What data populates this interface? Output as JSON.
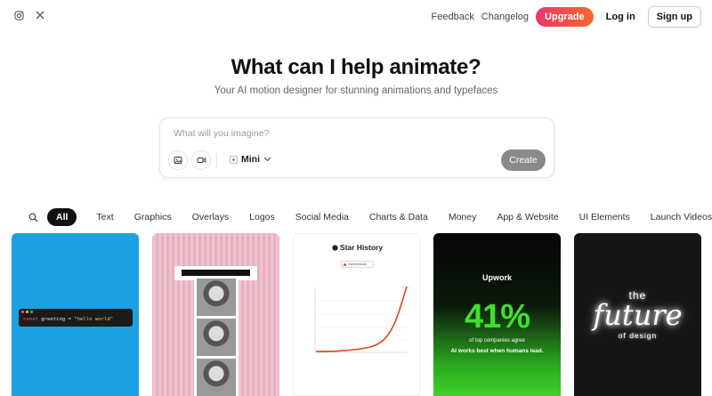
{
  "header": {
    "social": [
      {
        "icon": "instagram-icon"
      },
      {
        "icon": "x-icon"
      }
    ],
    "feedback": "Feedback",
    "changelog": "Changelog",
    "upgrade": "Upgrade",
    "login": "Log in",
    "signup": "Sign up",
    "accent_gradient": [
      "#e8356b",
      "#f36a2c"
    ]
  },
  "hero": {
    "title": "What can I help animate?",
    "subtitle": "Your AI motion designer for stunning animations and typefaces"
  },
  "prompt": {
    "placeholder": "What will you imagine?",
    "value": "",
    "model": "Mini",
    "create": "Create"
  },
  "categories": [
    "All",
    "Text",
    "Graphics",
    "Overlays",
    "Logos",
    "Social Media",
    "Charts & Data",
    "Money",
    "App & Website",
    "UI Elements",
    "Launch Videos"
  ],
  "active_category": "All",
  "cards": {
    "code": {
      "kw": "const",
      "var": "greeting",
      "eq": " = ",
      "str": "\"hello world\"",
      "bg": "#1ba1e2"
    },
    "star_history": {
      "title": "Star History",
      "legend": "Soleblyrteam"
    },
    "upwork": {
      "brand": "Upwork",
      "stat": "41%",
      "line1": "of top companies agree",
      "line2": "AI works best when humans lead."
    },
    "future": {
      "the": "the",
      "word": "future",
      "sub": "of design"
    }
  }
}
